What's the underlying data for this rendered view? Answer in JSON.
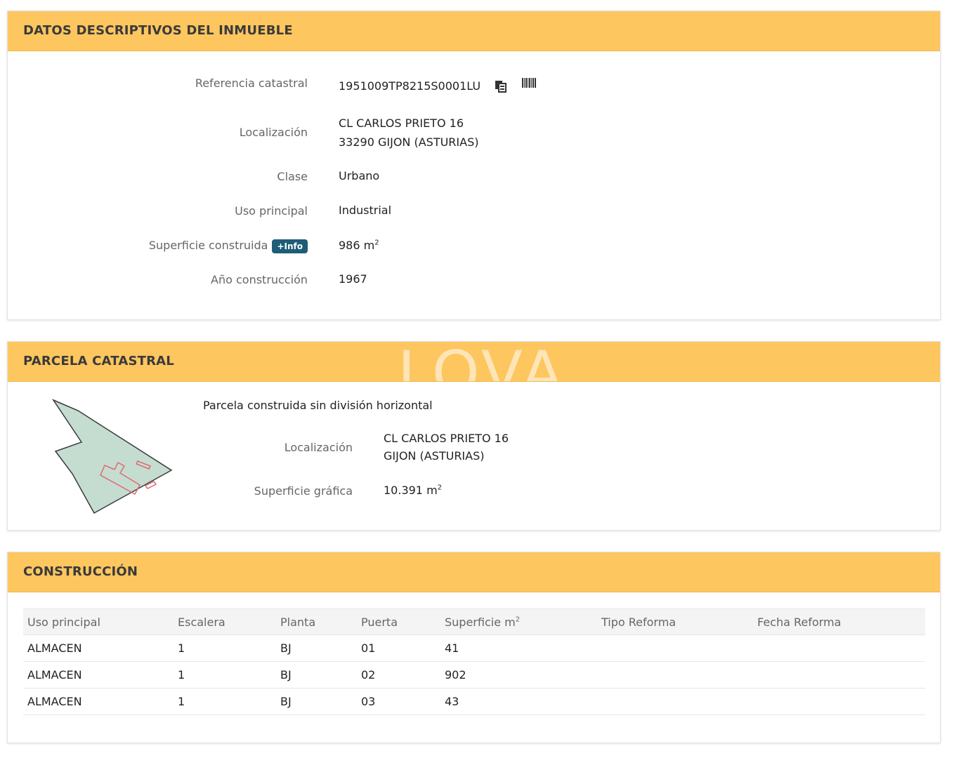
{
  "datos": {
    "title": "DATOS DESCRIPTIVOS DEL INMUEBLE",
    "referencia_label": "Referencia catastral",
    "referencia_value": "1951009TP8215S0001LU",
    "localizacion_label": "Localización",
    "localizacion_line1": "CL CARLOS PRIETO 16",
    "localizacion_line2": "33290 GIJON (ASTURIAS)",
    "clase_label": "Clase",
    "clase_value": "Urbano",
    "uso_label": "Uso principal",
    "uso_value": "Industrial",
    "superficie_label": "Superficie construida",
    "info_badge": "+Info",
    "superficie_value": "986 m",
    "superficie_sup": "2",
    "anio_label": "Año construcción",
    "anio_value": "1967"
  },
  "parcela": {
    "title": "PARCELA CATASTRAL",
    "watermark": "LOVA",
    "descripcion": "Parcela construida sin división horizontal",
    "localizacion_label": "Localización",
    "localizacion_line1": "CL CARLOS PRIETO 16",
    "localizacion_line2": "GIJON (ASTURIAS)",
    "superficie_label": "Superficie gráfica",
    "superficie_value": "10.391 m",
    "superficie_sup": "2"
  },
  "construccion": {
    "title": "CONSTRUCCIÓN",
    "headers": [
      "Uso principal",
      "Escalera",
      "Planta",
      "Puerta",
      "Superficie m",
      "Tipo Reforma",
      "Fecha Reforma"
    ],
    "superficie_sup": "2",
    "rows": [
      [
        "ALMACEN",
        "1",
        "BJ",
        "01",
        "41",
        "",
        ""
      ],
      [
        "ALMACEN",
        "1",
        "BJ",
        "02",
        "902",
        "",
        ""
      ],
      [
        "ALMACEN",
        "1",
        "BJ",
        "03",
        "43",
        "",
        ""
      ]
    ]
  },
  "colors": {
    "header_bg": "#fdc65f",
    "parcel_fill": "#c4ddd0",
    "building_outline": "#e06a75",
    "badge_bg": "#1f5c78"
  }
}
